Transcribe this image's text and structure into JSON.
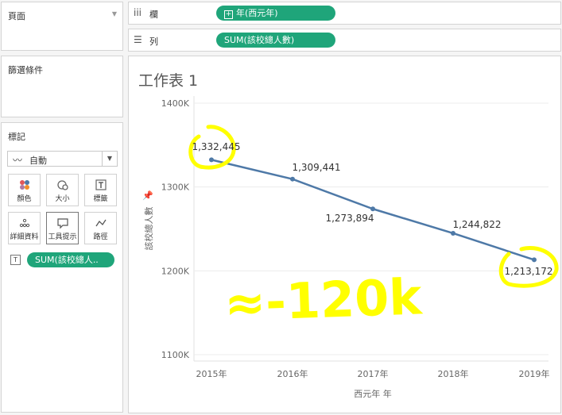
{
  "sidebar": {
    "pages_label": "頁面",
    "filters_label": "篩選條件",
    "marks": {
      "title": "標記",
      "type": "自動",
      "buttons": [
        "顏色",
        "大小",
        "標籤",
        "詳細資料",
        "工具提示",
        "路徑"
      ],
      "tooltip_pill": "SUM(該校總人.."
    }
  },
  "shelves": {
    "columns": {
      "label": "欄",
      "pill": "年(西元年)"
    },
    "rows": {
      "label": "列",
      "pill": "SUM(該校總人數)"
    }
  },
  "sheet": {
    "title": "工作表 1"
  },
  "chart_data": {
    "type": "line",
    "categories": [
      "2015年",
      "2016年",
      "2017年",
      "2018年",
      "2019年"
    ],
    "values": [
      1332445,
      1309441,
      1273894,
      1244822,
      1213172
    ],
    "data_labels": [
      "1,332,445",
      "1,309,441",
      "1,273,894",
      "1,244,822",
      "1,213,172"
    ],
    "xlabel": "西元年 年",
    "ylabel": "該校總人數",
    "ylim": [
      1100000,
      1400000
    ],
    "yticks": [
      "1100K",
      "1200K",
      "1300K",
      "1400K"
    ],
    "grid": true,
    "line_color": "#4e79a7",
    "annotation": {
      "text": "≈-120k",
      "color": "#ffff00"
    }
  }
}
